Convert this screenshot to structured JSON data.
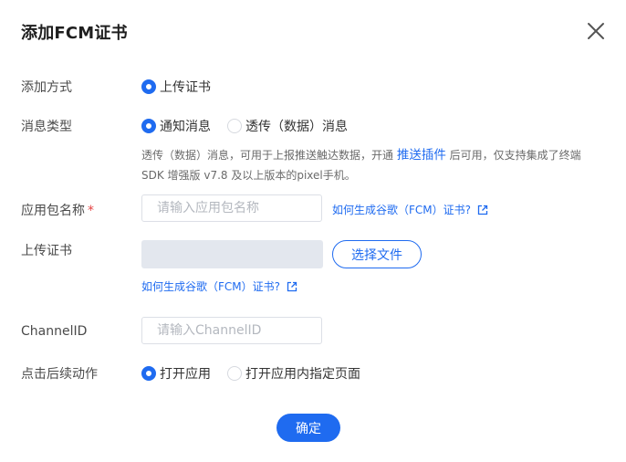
{
  "dialog": {
    "title": "添加FCM证书",
    "close_icon": "close-icon"
  },
  "add_method": {
    "label": "添加方式",
    "options": [
      {
        "label": "上传证书",
        "selected": true
      }
    ]
  },
  "message_type": {
    "label": "消息类型",
    "options": [
      {
        "label": "通知消息",
        "selected": true
      },
      {
        "label": "透传（数据）消息",
        "selected": false
      }
    ],
    "hint_before": "透传（数据）消息，可用于上报推送触达数据，开通 ",
    "hint_link": "推送插件",
    "hint_after": " 后可用，仅支持集成了终端SDK 增强版 v7.8 及以上版本的pixel手机。"
  },
  "package_name": {
    "label": "应用包名称",
    "required_mark": "*",
    "placeholder": "请输入应用包名称",
    "help_link": "如何生成谷歌（FCM）证书?"
  },
  "upload_cert": {
    "label": "上传证书",
    "button": "选择文件",
    "help_link": "如何生成谷歌（FCM）证书?"
  },
  "channel_id": {
    "label": "ChannelID",
    "placeholder": "请输入ChannelID"
  },
  "click_action": {
    "label": "点击后续动作",
    "options": [
      {
        "label": "打开应用",
        "selected": true
      },
      {
        "label": "打开应用内指定页面",
        "selected": false
      }
    ]
  },
  "footer": {
    "confirm": "确定"
  },
  "colors": {
    "accent": "#1f6bf0",
    "required": "#e54545"
  }
}
